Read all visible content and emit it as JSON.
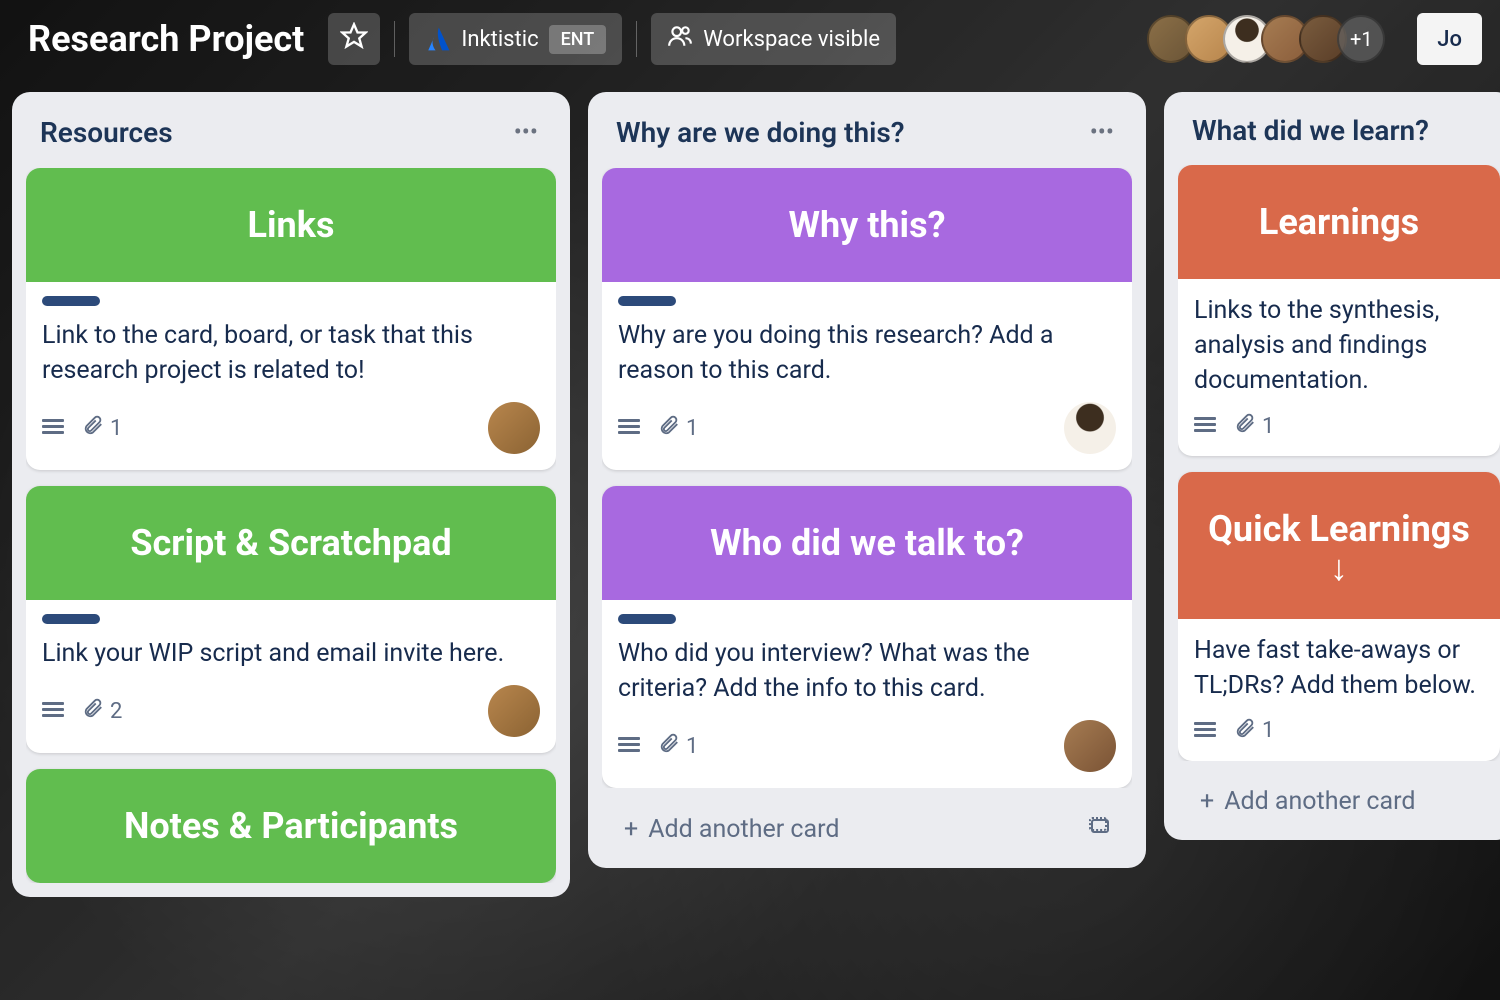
{
  "header": {
    "board_title": "Research Project",
    "workspace_name": "Inktistic",
    "workspace_badge": "ENT",
    "visibility_label": "Workspace visible",
    "member_overflow": "+1",
    "join_label": "Jo"
  },
  "lists": [
    {
      "title": "Resources",
      "cards": [
        {
          "cover_text": "Links",
          "cover_color": "green",
          "text": "Link to the card, board, or task that this research project is related to!",
          "attachments": "1",
          "has_desc": true,
          "avatar": "cav1"
        },
        {
          "cover_text": "Script & Scratchpad",
          "cover_color": "green",
          "text": "Link your WIP script and email invite here.",
          "attachments": "2",
          "has_desc": true,
          "avatar": "cav1"
        },
        {
          "cover_text": "Notes & Participants",
          "cover_color": "green"
        }
      ],
      "show_add": false
    },
    {
      "title": "Why are we doing this?",
      "cards": [
        {
          "cover_text": "Why this?",
          "cover_color": "purple",
          "text": "Why are you doing this research? Add a reason to this card.",
          "attachments": "1",
          "has_desc": true,
          "avatar": "cav2"
        },
        {
          "cover_text": "Who did we talk to?",
          "cover_color": "purple",
          "text": "Who did you interview? What was the criteria? Add the info to this card.",
          "attachments": "1",
          "has_desc": true,
          "avatar": "cav3"
        }
      ],
      "add_label": "Add another card",
      "show_add": true,
      "show_template": true
    },
    {
      "title": "What did we learn?",
      "cards": [
        {
          "cover_text": "Learnings",
          "cover_color": "red",
          "text": "Links to the synthesis, analysis and findings documentation.",
          "attachments": "1",
          "has_desc": true,
          "no_label": true
        },
        {
          "cover_text": "Quick Learnings",
          "cover_has_arrow": true,
          "cover_color": "red",
          "text": "Have fast take-aways or TL;DRs? Add them below.",
          "attachments": "1",
          "has_desc": true,
          "no_label": true
        }
      ],
      "add_label": "Add another card",
      "show_add": true,
      "show_template": false
    }
  ]
}
